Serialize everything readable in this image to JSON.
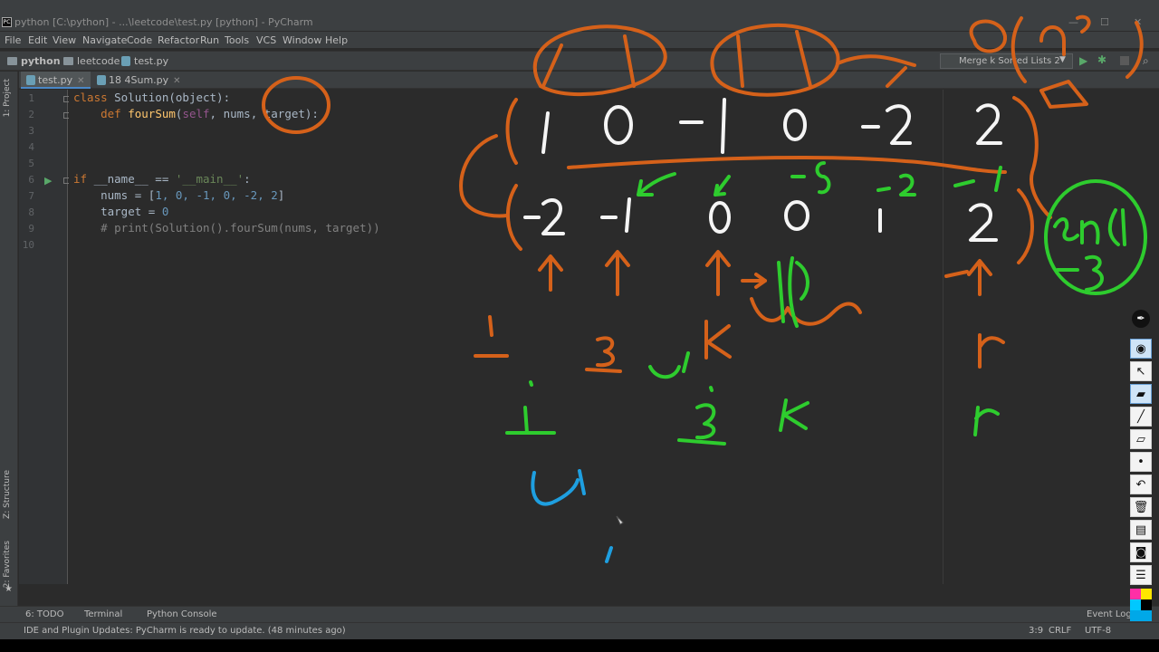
{
  "window": {
    "title": "python [C:\\python] - ...\\leetcode\\test.py [python] - PyCharm",
    "app_icon": "PC"
  },
  "menu": [
    "File",
    "Edit",
    "View",
    "Navigate",
    "Code",
    "Refactor",
    "Run",
    "Tools",
    "VCS",
    "Window",
    "Help"
  ],
  "breadcrumb": [
    "python",
    "leetcode",
    "test.py"
  ],
  "run_config": {
    "label": "Merge k Sorted Lists 2"
  },
  "side_tabs": {
    "project": "1: Project",
    "structure": "Z: Structure",
    "favorites": "2: Favorites"
  },
  "tabs": [
    {
      "label": "test.py",
      "active": true
    },
    {
      "label": "18 4Sum.py",
      "active": false
    }
  ],
  "line_numbers": [
    "1",
    "2",
    "3",
    "4",
    "5",
    "6",
    "7",
    "8",
    "9",
    "10"
  ],
  "code": {
    "l1": {
      "kw": "class ",
      "text": "Solution(object):"
    },
    "l2": {
      "kw": "def ",
      "fn": "fourSum",
      "open": "(",
      "self": "self",
      "rest": ", nums, target):"
    },
    "l6": {
      "kw": "if ",
      "text1": "__name__ == ",
      "str": "'__main__'",
      "text2": ":"
    },
    "l7": {
      "pre": "nums = [",
      "nums": "1, 0, -1, 0, -2, 2",
      "post": "]"
    },
    "l8": {
      "pre": "target = ",
      "num": "0"
    },
    "l9": {
      "comment": "# print(Solution().fourSum(nums, target))"
    }
  },
  "bottom_tools": [
    "6: TODO",
    "Terminal",
    "Python Console"
  ],
  "event_log": "Event Log",
  "status": {
    "message": "IDE and Plugin Updates: PyCharm is ready to update. (48 minutes ago)",
    "position": "3:9",
    "line_sep": "CRLF",
    "encoding": "UTF-8"
  },
  "colors": {
    "orange_ink": "#d5611a",
    "green_ink": "#2ecc2e",
    "blue_ink": "#1e9fe0",
    "white_ink": "#f5f5f5"
  },
  "handwriting": {
    "row1": [
      "1",
      "0",
      "-1",
      "0",
      "-2",
      "2"
    ],
    "row2": [
      "-2",
      "-1",
      "0",
      "0",
      "1",
      "2"
    ],
    "complexity": "O(n^3)",
    "pointers_orange": [
      "i",
      "j",
      "k",
      "r"
    ],
    "pointers_green": [
      "i",
      "j",
      "k",
      "r"
    ],
    "green_sums": [
      "-5",
      "-2",
      "-1"
    ],
    "bubble": "len(l) -3"
  },
  "draw_tools": [
    "pen-tip-icon",
    "eye-icon",
    "cursor-icon",
    "highlighter-icon",
    "pen-icon",
    "eraser-icon",
    "dot-icon",
    "undo-icon",
    "trash-icon",
    "whiteboard-icon",
    "camera-icon",
    "notes-icon"
  ]
}
